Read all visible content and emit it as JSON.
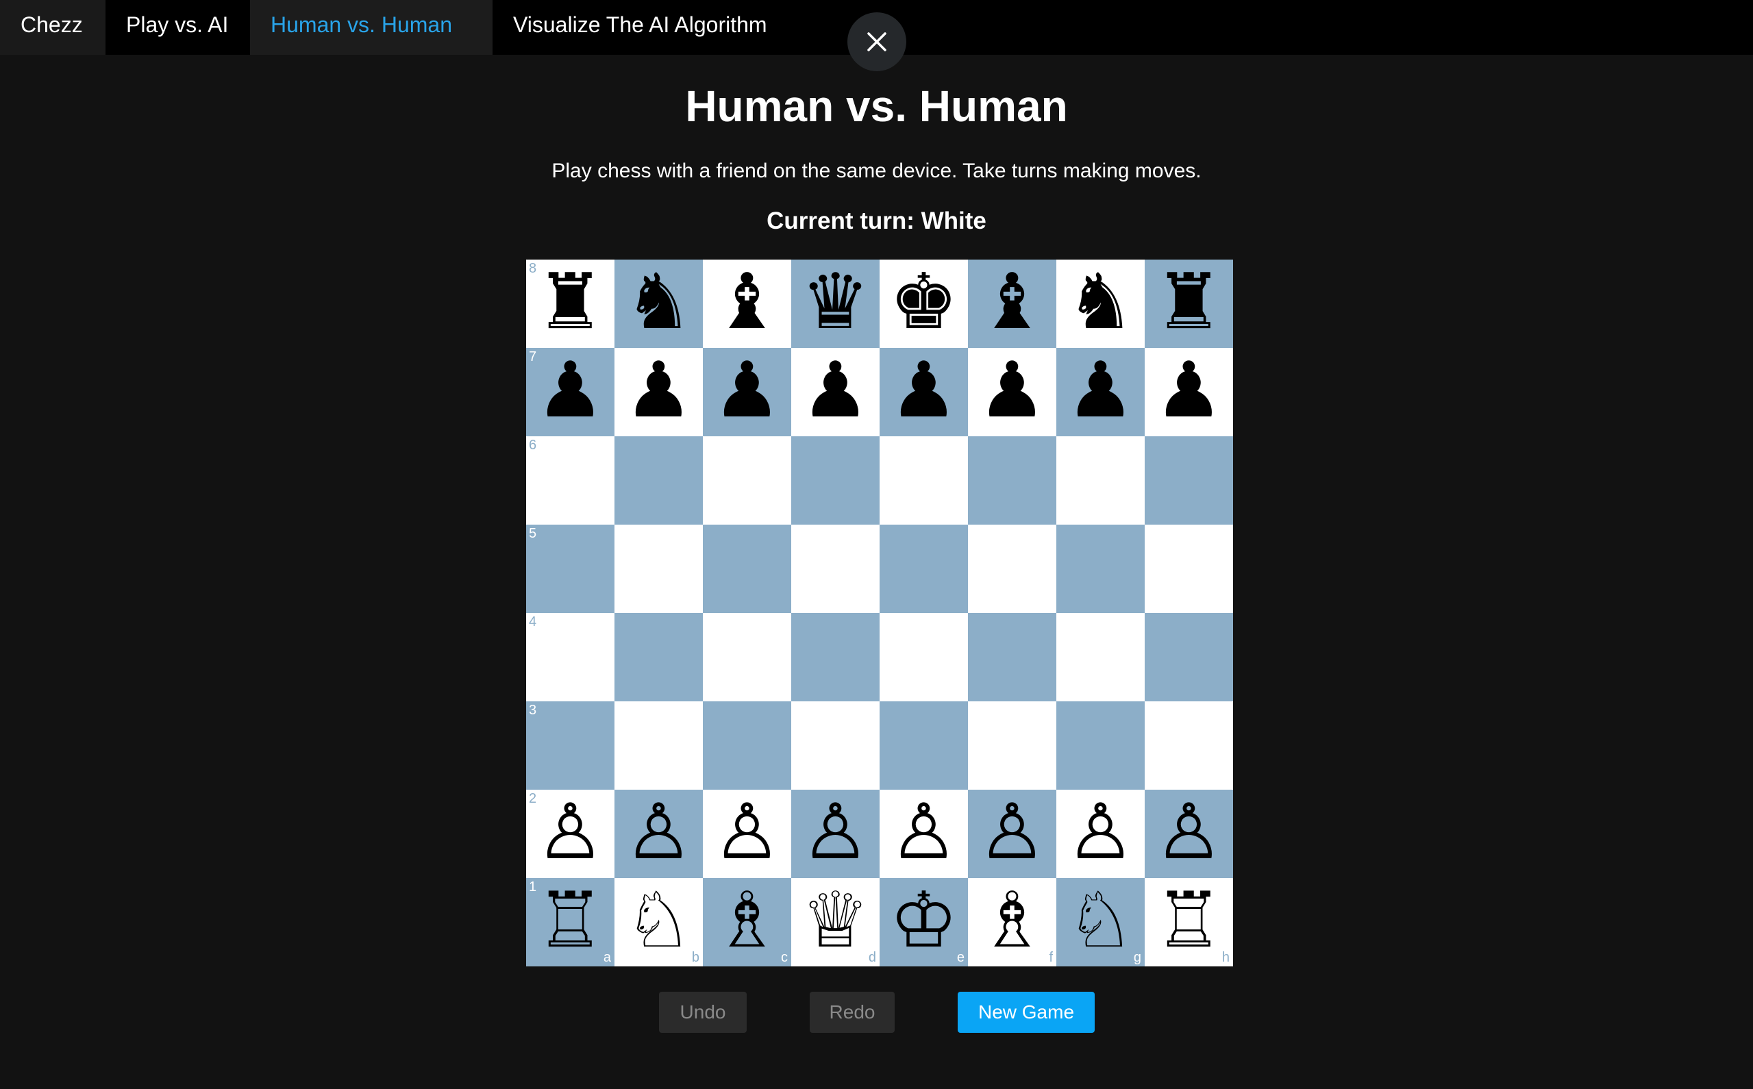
{
  "nav": {
    "brand": "Chezz",
    "tabs": [
      {
        "label": "Play vs. AI"
      },
      {
        "label": "Human vs. Human"
      },
      {
        "label": "Visualize The AI Algorithm"
      }
    ],
    "active_tab": "Human vs. Human",
    "active_color": "#29a3e8"
  },
  "page": {
    "title": "Human vs. Human",
    "subtitle": "Play chess with a friend on the same device. Take turns making moves.",
    "turn_text": "Current turn: White"
  },
  "board": {
    "light_color": "#ffffff",
    "dark_color": "#8caec8",
    "ranks": [
      "8",
      "7",
      "6",
      "5",
      "4",
      "3",
      "2",
      "1"
    ],
    "files": [
      "a",
      "b",
      "c",
      "d",
      "e",
      "f",
      "g",
      "h"
    ],
    "rows": [
      [
        "♜",
        "♞",
        "♝",
        "♛",
        "♚",
        "♝",
        "♞",
        "♜"
      ],
      [
        "♟",
        "♟",
        "♟",
        "♟",
        "♟",
        "♟",
        "♟",
        "♟"
      ],
      [
        "",
        "",
        "",
        "",
        "",
        "",
        "",
        ""
      ],
      [
        "",
        "",
        "",
        "",
        "",
        "",
        "",
        ""
      ],
      [
        "",
        "",
        "",
        "",
        "",
        "",
        "",
        ""
      ],
      [
        "",
        "",
        "",
        "",
        "",
        "",
        "",
        ""
      ],
      [
        "♙",
        "♙",
        "♙",
        "♙",
        "♙",
        "♙",
        "♙",
        "♙"
      ],
      [
        "♖",
        "♘",
        "♗",
        "♕",
        "♔",
        "♗",
        "♘",
        "♖"
      ]
    ],
    "piece_names": {
      "♜": "black-rook-icon",
      "♞": "black-knight-icon",
      "♝": "black-bishop-icon",
      "♛": "black-queen-icon",
      "♚": "black-king-icon",
      "♟": "black-pawn-icon",
      "♖": "white-rook-icon",
      "♘": "white-knight-icon",
      "♗": "white-bishop-icon",
      "♕": "white-queen-icon",
      "♔": "white-king-icon",
      "♙": "white-pawn-icon"
    }
  },
  "controls": {
    "undo_label": "Undo",
    "redo_label": "Redo",
    "new_game_label": "New Game",
    "new_game_color": "#0aa5f5"
  },
  "close_icon": "close-icon"
}
